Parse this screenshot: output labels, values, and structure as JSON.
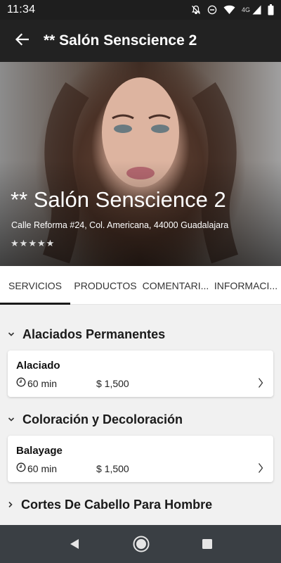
{
  "status_bar": {
    "time": "11:34",
    "network": "4G",
    "icons": [
      "notifications-off-icon",
      "do-not-disturb-icon",
      "wifi-icon",
      "cell-signal-icon",
      "battery-icon"
    ]
  },
  "app_bar": {
    "title": "** Salón Senscience 2",
    "back_icon": "arrow-left-icon"
  },
  "hero": {
    "title": "** Salón Senscience 2",
    "address": "Calle Reforma  #24, Col. Americana, 44000 Guadalajara",
    "rating": 5,
    "rating_max": 5
  },
  "tabs": [
    {
      "label": "SERVICIOS",
      "active": true
    },
    {
      "label": "PRODUCTOS",
      "active": false
    },
    {
      "label": "COMENTARI...",
      "active": false
    },
    {
      "label": "INFORMACI...",
      "active": false
    }
  ],
  "sections": [
    {
      "title": "Alaciados Permanentes",
      "expanded": true,
      "services": [
        {
          "name": "Alaciado",
          "duration": "60 min",
          "price": "$ 1,500"
        }
      ]
    },
    {
      "title": "Coloración y Decoloración",
      "expanded": true,
      "services": [
        {
          "name": "Balayage",
          "duration": "60 min",
          "price": "$ 1,500"
        }
      ]
    },
    {
      "title": "Cortes De Cabello Para Hombre",
      "expanded": false,
      "services": []
    }
  ],
  "colors": {
    "status_bar": "#1e1e1e",
    "app_bar": "#222222",
    "background": "#f1f1f1",
    "nav_bar": "#3a3f44"
  },
  "nav_bar": {
    "icons": [
      "back-triangle-icon",
      "home-circle-icon",
      "recents-square-icon"
    ]
  }
}
